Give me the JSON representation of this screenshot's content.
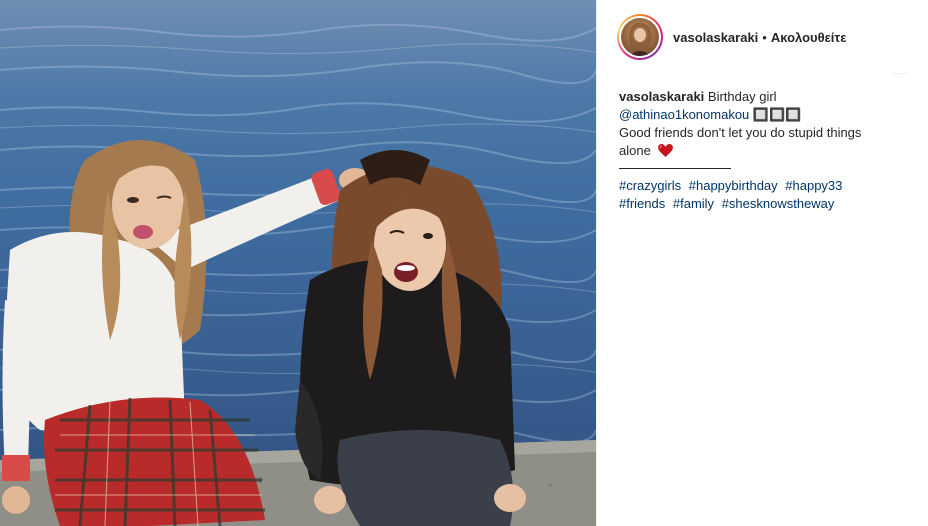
{
  "header": {
    "username": "vasolaskaraki",
    "separator": "•",
    "follow_label": "Ακολουθείτε"
  },
  "caption": {
    "username": "vasolaskaraki",
    "line1": "Birthday girl",
    "mention": "@athinao1konomakou",
    "mention_suffix": "🔲🔲🔲",
    "line3": "Good friends don't let you do stupid things",
    "line4": "alone",
    "divider": "———————————",
    "tags_row1": [
      "#crazygirls",
      "#happybirthday",
      "#happy33"
    ],
    "tags_row2": [
      "#friends",
      "#family",
      "#sheskn owstheway"
    ]
  },
  "colors": {
    "link": "#003569",
    "text": "#262626",
    "heart": "#e0245e"
  },
  "icons": {
    "heart": "heart-emoji",
    "avatar": "profile-avatar"
  }
}
